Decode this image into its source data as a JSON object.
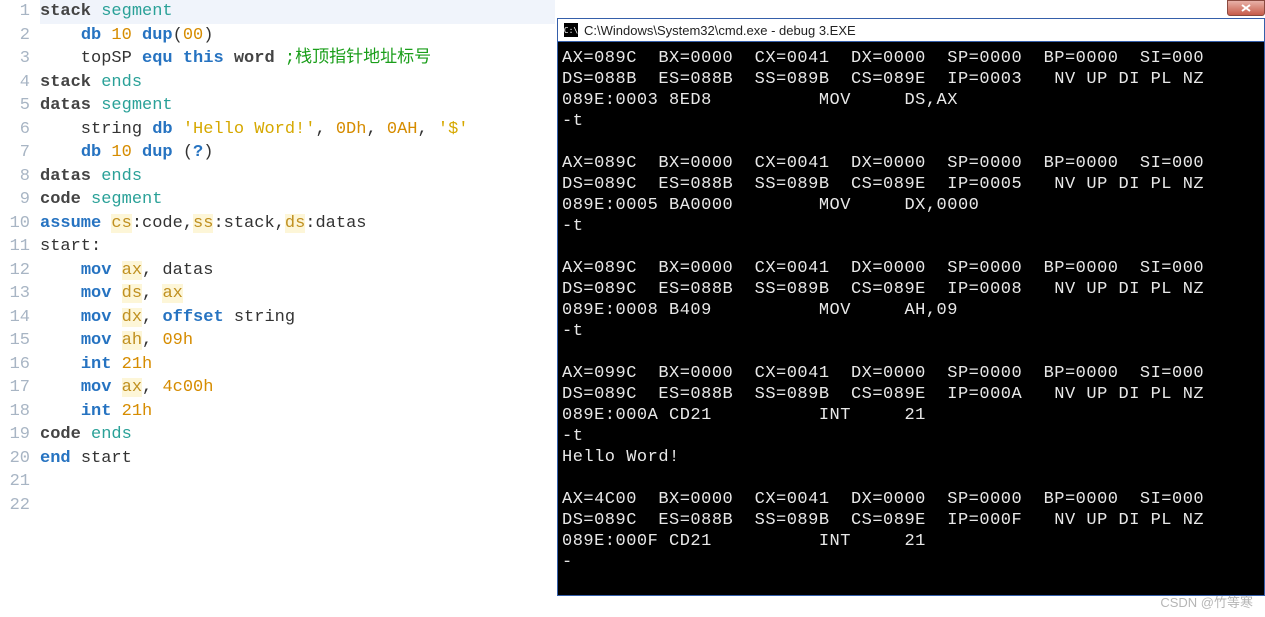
{
  "editor": {
    "line_numbers": [
      "1",
      "2",
      "3",
      "4",
      "5",
      "6",
      "7",
      "8",
      "9",
      "10",
      "11",
      "12",
      "13",
      "14",
      "15",
      "16",
      "17",
      "18",
      "19",
      "20",
      "21",
      "22"
    ],
    "lines": [
      {
        "indent": 0,
        "tokens": [
          {
            "t": "stack ",
            "c": "black"
          },
          {
            "t": "segment",
            "c": "kw-teal"
          }
        ],
        "hl": true
      },
      {
        "indent": 1,
        "tokens": [
          {
            "t": "db ",
            "c": "kw-blue"
          },
          {
            "t": "10 ",
            "c": "num"
          },
          {
            "t": "dup",
            "c": "kw-blue"
          },
          {
            "t": "(",
            "c": ""
          },
          {
            "t": "00",
            "c": "num"
          },
          {
            "t": ")",
            "c": ""
          }
        ]
      },
      {
        "indent": 1,
        "tokens": [
          {
            "t": "topSP ",
            "c": ""
          },
          {
            "t": "equ ",
            "c": "kw-blue"
          },
          {
            "t": "this ",
            "c": "kw-blue"
          },
          {
            "t": "word ",
            "c": "black"
          },
          {
            "t": ";栈顶指针地址标号",
            "c": "comment"
          }
        ]
      },
      {
        "indent": 0,
        "tokens": [
          {
            "t": "stack ",
            "c": "black"
          },
          {
            "t": "ends",
            "c": "kw-teal"
          }
        ]
      },
      {
        "indent": 0,
        "tokens": [
          {
            "t": "datas ",
            "c": "black"
          },
          {
            "t": "segment",
            "c": "kw-teal"
          }
        ]
      },
      {
        "indent": 1,
        "tokens": [
          {
            "t": "string ",
            "c": ""
          },
          {
            "t": "db ",
            "c": "kw-blue"
          },
          {
            "t": "'Hello Word!'",
            "c": "str"
          },
          {
            "t": ", ",
            "c": ""
          },
          {
            "t": "0Dh",
            "c": "num"
          },
          {
            "t": ", ",
            "c": ""
          },
          {
            "t": "0AH",
            "c": "num"
          },
          {
            "t": ", ",
            "c": ""
          },
          {
            "t": "'$'",
            "c": "str"
          }
        ]
      },
      {
        "indent": 1,
        "tokens": [
          {
            "t": "db ",
            "c": "kw-blue"
          },
          {
            "t": "10 ",
            "c": "num"
          },
          {
            "t": "dup ",
            "c": "kw-blue"
          },
          {
            "t": "(",
            "c": ""
          },
          {
            "t": "?",
            "c": "kw-blue"
          },
          {
            "t": ")",
            "c": ""
          }
        ]
      },
      {
        "indent": 0,
        "tokens": [
          {
            "t": "datas ",
            "c": "black"
          },
          {
            "t": "ends",
            "c": "kw-teal"
          }
        ]
      },
      {
        "indent": 0,
        "tokens": [
          {
            "t": "code ",
            "c": "black"
          },
          {
            "t": "segment",
            "c": "kw-teal"
          }
        ]
      },
      {
        "indent": 0,
        "tokens": [
          {
            "t": "assume ",
            "c": "kw-blue"
          },
          {
            "t": "cs",
            "c": "reg"
          },
          {
            "t": ":code,",
            "c": ""
          },
          {
            "t": "ss",
            "c": "reg"
          },
          {
            "t": ":stack,",
            "c": ""
          },
          {
            "t": "ds",
            "c": "reg"
          },
          {
            "t": ":datas",
            "c": ""
          }
        ]
      },
      {
        "indent": 0,
        "tokens": [
          {
            "t": "start:",
            "c": ""
          }
        ]
      },
      {
        "indent": 1,
        "tokens": [
          {
            "t": "mov ",
            "c": "kw-blue"
          },
          {
            "t": "ax",
            "c": "reg"
          },
          {
            "t": ", datas",
            "c": ""
          }
        ]
      },
      {
        "indent": 1,
        "tokens": [
          {
            "t": "mov ",
            "c": "kw-blue"
          },
          {
            "t": "ds",
            "c": "reg"
          },
          {
            "t": ", ",
            "c": ""
          },
          {
            "t": "ax",
            "c": "reg"
          }
        ]
      },
      {
        "indent": 1,
        "tokens": [
          {
            "t": "mov ",
            "c": "kw-blue"
          },
          {
            "t": "dx",
            "c": "reg"
          },
          {
            "t": ", ",
            "c": ""
          },
          {
            "t": "offset ",
            "c": "kw-blue"
          },
          {
            "t": "string",
            "c": ""
          }
        ]
      },
      {
        "indent": 1,
        "tokens": [
          {
            "t": "mov ",
            "c": "kw-blue"
          },
          {
            "t": "ah",
            "c": "reg"
          },
          {
            "t": ", ",
            "c": ""
          },
          {
            "t": "09h",
            "c": "num"
          }
        ]
      },
      {
        "indent": 1,
        "tokens": [
          {
            "t": "int ",
            "c": "kw-blue"
          },
          {
            "t": "21h",
            "c": "num"
          }
        ]
      },
      {
        "indent": 1,
        "tokens": [
          {
            "t": "mov ",
            "c": "kw-blue"
          },
          {
            "t": "ax",
            "c": "reg"
          },
          {
            "t": ", ",
            "c": ""
          },
          {
            "t": "4c00h",
            "c": "num"
          }
        ]
      },
      {
        "indent": 1,
        "tokens": [
          {
            "t": "int ",
            "c": "kw-blue"
          },
          {
            "t": "21h",
            "c": "num"
          }
        ]
      },
      {
        "indent": 0,
        "tokens": [
          {
            "t": "code ",
            "c": "black"
          },
          {
            "t": "ends",
            "c": "kw-teal"
          }
        ]
      },
      {
        "indent": 0,
        "tokens": [
          {
            "t": "end ",
            "c": "kw-blue"
          },
          {
            "t": "start",
            "c": ""
          }
        ]
      },
      {
        "indent": 0,
        "tokens": []
      },
      {
        "indent": 0,
        "tokens": []
      }
    ]
  },
  "terminal": {
    "title": "C:\\Windows\\System32\\cmd.exe - debug  3.EXE",
    "lines": [
      "AX=089C  BX=0000  CX=0041  DX=0000  SP=0000  BP=0000  SI=000",
      "DS=088B  ES=088B  SS=089B  CS=089E  IP=0003   NV UP DI PL NZ",
      "089E:0003 8ED8          MOV     DS,AX",
      "-t",
      "",
      "AX=089C  BX=0000  CX=0041  DX=0000  SP=0000  BP=0000  SI=000",
      "DS=089C  ES=088B  SS=089B  CS=089E  IP=0005   NV UP DI PL NZ",
      "089E:0005 BA0000        MOV     DX,0000",
      "-t",
      "",
      "AX=089C  BX=0000  CX=0041  DX=0000  SP=0000  BP=0000  SI=000",
      "DS=089C  ES=088B  SS=089B  CS=089E  IP=0008   NV UP DI PL NZ",
      "089E:0008 B409          MOV     AH,09",
      "-t",
      "",
      "AX=099C  BX=0000  CX=0041  DX=0000  SP=0000  BP=0000  SI=000",
      "DS=089C  ES=088B  SS=089B  CS=089E  IP=000A   NV UP DI PL NZ",
      "089E:000A CD21          INT     21",
      "-t",
      "Hello Word!",
      "",
      "AX=4C00  BX=0000  CX=0041  DX=0000  SP=0000  BP=0000  SI=000",
      "DS=089C  ES=088B  SS=089B  CS=089E  IP=000F   NV UP DI PL NZ",
      "089E:000F CD21          INT     21",
      "-"
    ]
  },
  "watermark": "CSDN @竹等寒"
}
